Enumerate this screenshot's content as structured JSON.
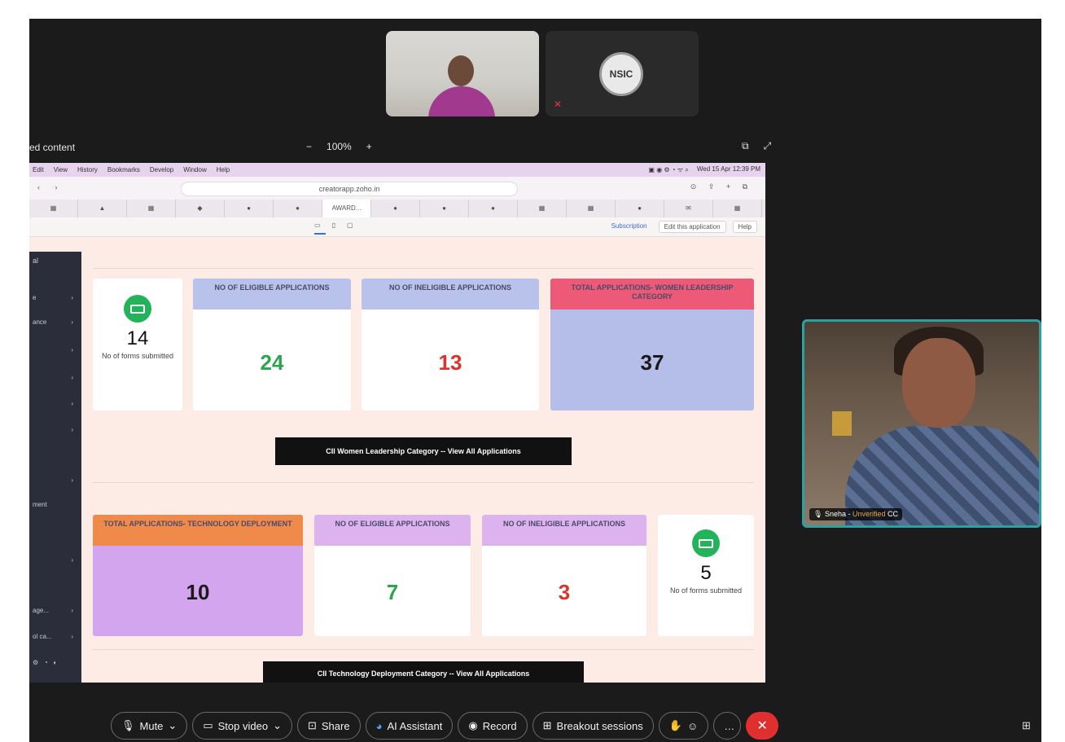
{
  "meeting": {
    "participant2_initials": "NSIC",
    "share_title": "ed content",
    "zoom_level": "100%",
    "zoom_minus": "−",
    "zoom_plus": "+"
  },
  "mac_menu": {
    "items": [
      "Edit",
      "View",
      "History",
      "Bookmarks",
      "Develop",
      "Window",
      "Help"
    ],
    "clock": "Wed 15 Apr 12:39 PM"
  },
  "browser": {
    "url": "creatorapp.zoho.in",
    "active_tab": "AWARD..."
  },
  "app": {
    "submit_label": "Subscription",
    "edit_label": "Edit this application",
    "help_label": "Help"
  },
  "sidebar": {
    "top_label": "al",
    "items": [
      "e",
      "ance",
      "",
      "",
      "",
      "",
      "",
      "ment",
      "",
      "age...",
      "ol ca..."
    ]
  },
  "section1": {
    "count_value": "14",
    "count_label": "No of forms submitted",
    "eligible_title": "NO OF ELIGIBLE APPLICATIONS",
    "eligible_value": "24",
    "ineligible_title": "NO OF INELIGIBLE APPLICATIONS",
    "ineligible_value": "13",
    "total_title": "TOTAL APPLICATIONS- WOMEN LEADERSHIP CATEGORY",
    "total_value": "37",
    "button_label": "CII Women Leadership Category -- View All Applications"
  },
  "section2": {
    "total_title": "TOTAL APPLICATIONS- TECHNOLOGY DEPLOYMENT",
    "total_value": "10",
    "eligible_title": "NO OF ELIGIBLE APPLICATIONS",
    "eligible_value": "7",
    "ineligible_title": "NO OF INELIGIBLE APPLICATIONS",
    "ineligible_value": "3",
    "count_value": "5",
    "count_label": "No of forms submitted",
    "button_label": "CII Technology Deployment Category -- View All Applications"
  },
  "camera2": {
    "name": "Sneha",
    "status": "Unverified"
  },
  "toolbar": {
    "mute": "Mute",
    "stop_video": "Stop video",
    "share": "Share",
    "ai_assistant": "AI Assistant",
    "record": "Record",
    "breakout": "Breakout sessions"
  },
  "colors": {
    "eligible_header": "#b9c2ea",
    "women_total_header": "#ec5a78",
    "women_total_body": "#b5bde9",
    "tech_total_header": "#f08a4b",
    "tech_total_body": "#d3a5ef",
    "tech_sub_header": "#dcb3ef",
    "green_value": "#2da44e",
    "red_value": "#d9352c"
  }
}
